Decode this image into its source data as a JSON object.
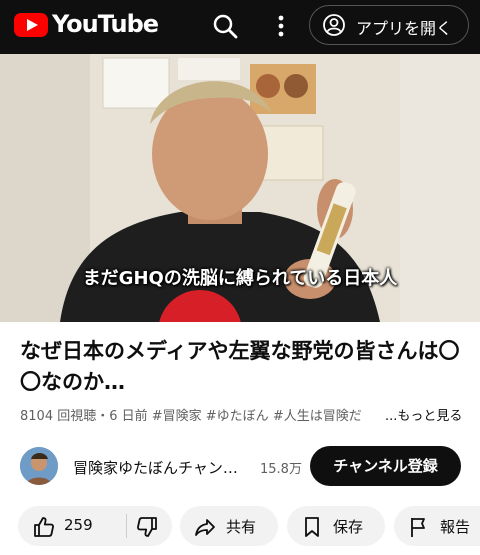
{
  "header": {
    "brand": "YouTube",
    "open_app_label": "アプリを開く"
  },
  "video": {
    "caption": "まだGHQの洗脳に縛られている日本人"
  },
  "title": "なぜ日本のメディアや左翼な野党の皆さんは〇〇なのか…",
  "meta": {
    "views_date": "8104 回視聴・6 日前",
    "tags": "#冒険家 #ゆたぼん #人生は冒険だ",
    "more_label": "...もっと見る"
  },
  "channel": {
    "name": "冒険家ゆたぼんチャン…",
    "subscribers": "15.8万",
    "subscribe_label": "チャンネル登録"
  },
  "actions": {
    "like_count": "259",
    "share_label": "共有",
    "save_label": "保存",
    "report_label": "報告"
  },
  "colors": {
    "header_bg": "#0f0f0f",
    "brand_red": "#ff0000",
    "pill_bg": "#f2f2f2"
  }
}
